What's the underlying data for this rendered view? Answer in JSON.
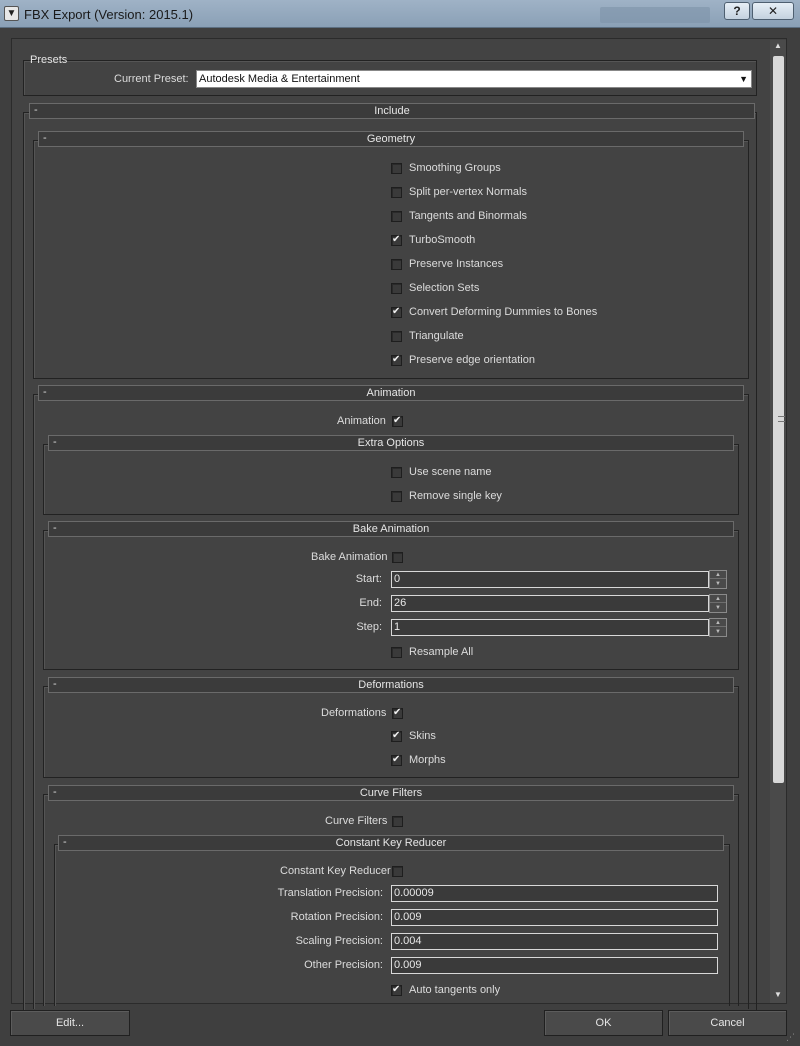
{
  "window": {
    "title": "FBX Export (Version: 2015.1)",
    "help_label": "?",
    "close_label": "✕"
  },
  "presets": {
    "group_label": "Presets",
    "current_preset_label": "Current Preset:",
    "current_preset_value": "Autodesk Media & Entertainment"
  },
  "include": {
    "label": "Include"
  },
  "geometry": {
    "label": "Geometry",
    "options": [
      {
        "label": "Smoothing Groups",
        "checked": false
      },
      {
        "label": "Split per-vertex Normals",
        "checked": false
      },
      {
        "label": "Tangents and Binormals",
        "checked": false
      },
      {
        "label": "TurboSmooth",
        "checked": true
      },
      {
        "label": "Preserve Instances",
        "checked": false
      },
      {
        "label": "Selection Sets",
        "checked": false
      },
      {
        "label": "Convert Deforming Dummies to Bones",
        "checked": true
      },
      {
        "label": "Triangulate",
        "checked": false
      },
      {
        "label": "Preserve edge orientation",
        "checked": true
      }
    ]
  },
  "animation": {
    "label": "Animation",
    "animation_label": "Animation",
    "animation_checked": true,
    "extra_options": {
      "label": "Extra Options",
      "options": [
        {
          "label": "Use scene name",
          "checked": false
        },
        {
          "label": "Remove single key",
          "checked": false
        }
      ]
    },
    "bake": {
      "label": "Bake Animation",
      "bake_label": "Bake Animation",
      "bake_checked": false,
      "start_label": "Start:",
      "start_value": "0",
      "end_label": "End:",
      "end_value": "26",
      "step_label": "Step:",
      "step_value": "1",
      "resample_label": "Resample All",
      "resample_checked": false
    },
    "deformations": {
      "label": "Deformations",
      "deformations_label": "Deformations",
      "deformations_checked": true,
      "skins_label": "Skins",
      "skins_checked": true,
      "morphs_label": "Morphs",
      "morphs_checked": true
    },
    "curve_filters": {
      "label": "Curve Filters",
      "curve_filters_label": "Curve Filters",
      "curve_filters_checked": false,
      "constant_key_reducer": {
        "label": "Constant Key Reducer",
        "ckr_label": "Constant Key Reducer",
        "ckr_checked": false,
        "translation_label": "Translation Precision:",
        "translation_value": "0.00009",
        "rotation_label": "Rotation Precision:",
        "rotation_value": "0.009",
        "scaling_label": "Scaling Precision:",
        "scaling_value": "0.004",
        "other_label": "Other Precision:",
        "other_value": "0.009",
        "auto_tangents_label": "Auto tangents only",
        "auto_tangents_checked": true
      }
    }
  },
  "footer": {
    "edit_label": "Edit...",
    "ok_label": "OK",
    "cancel_label": "Cancel"
  },
  "colors": {
    "background": "#3f3f3f",
    "title_bar": "#9fb2c6",
    "text": "#dcdcdc",
    "field_border": "#d8d8d8"
  }
}
